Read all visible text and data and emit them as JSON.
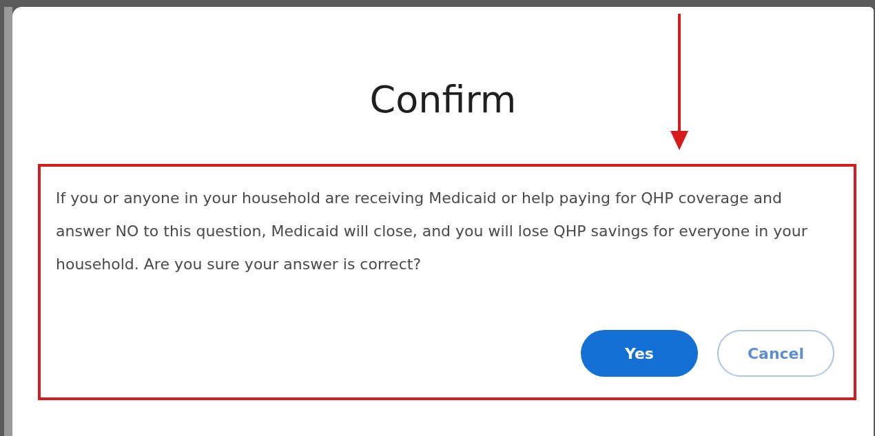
{
  "dialog": {
    "title": "Confirm",
    "message": "If you or anyone in your household are receiving Medicaid or help paying for QHP coverage and answer NO to this question, Medicaid will close, and you will lose QHP savings for everyone in your household. Are you sure your answer is correct?",
    "buttons": [
      {
        "label": "Yes",
        "kind": "primary"
      },
      {
        "label": "Cancel",
        "kind": "secondary"
      }
    ]
  }
}
